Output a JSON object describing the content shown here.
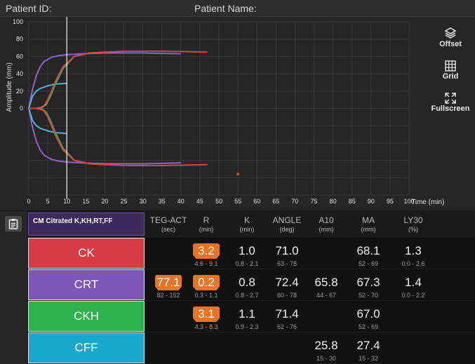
{
  "header": {
    "patient_id_label": "Patient ID:",
    "patient_name_label": "Patient Name:"
  },
  "side_buttons": {
    "offset": "Offset",
    "grid": "Grid",
    "fullscreen": "Fullscreen"
  },
  "chart_data": {
    "type": "line",
    "ylabel": "Amplitude (mm)",
    "xlabel": "Time (min)",
    "x_ticks": [
      "0",
      "5",
      "10",
      "15",
      "20",
      "25",
      "30",
      "35",
      "40",
      "45",
      "50",
      "55",
      "60",
      "65",
      "70",
      "75",
      "80",
      "85",
      "90",
      "95",
      "100"
    ],
    "y_ticks": [
      "100",
      "80",
      "60",
      "40",
      "20",
      "0"
    ],
    "xlim": [
      0,
      100
    ],
    "ylim": [
      -100,
      100
    ],
    "grid": true,
    "marker_x": 10,
    "series": [
      {
        "color": "#8e63c7",
        "x": [
          0,
          1,
          2,
          3,
          4,
          6,
          8,
          10,
          14,
          20,
          30,
          40
        ],
        "y": [
          0,
          22,
          38,
          48,
          54,
          59,
          61,
          62,
          63,
          64,
          64,
          63
        ]
      },
      {
        "color": "#4db3dc",
        "x": [
          0,
          1,
          2,
          3,
          5,
          7,
          10
        ],
        "y": [
          0,
          14,
          20,
          23,
          26,
          28,
          29
        ]
      },
      {
        "color": "#2fb25a",
        "x": [
          0,
          2,
          3.5,
          4.5,
          5.5,
          7,
          9,
          12,
          16,
          20
        ],
        "y": [
          0,
          0,
          1,
          4,
          12,
          28,
          46,
          60,
          64,
          65
        ]
      },
      {
        "color": "#e0404b",
        "x": [
          0,
          2,
          3,
          4,
          5,
          6,
          7,
          9,
          12,
          16,
          25,
          35,
          47
        ],
        "y": [
          0,
          0,
          1,
          3,
          10,
          20,
          31,
          48,
          60,
          64,
          66,
          66,
          65
        ]
      },
      {
        "color": "#8e63c7",
        "x": [
          0,
          1,
          2,
          3,
          4,
          6,
          8,
          10,
          14,
          20,
          30,
          40
        ],
        "y": [
          0,
          -22,
          -38,
          -48,
          -54,
          -59,
          -61,
          -62,
          -63,
          -64,
          -64,
          -63
        ]
      },
      {
        "color": "#4db3dc",
        "x": [
          0,
          1,
          2,
          3,
          5,
          7,
          10
        ],
        "y": [
          0,
          -14,
          -20,
          -23,
          -26,
          -28,
          -29
        ]
      },
      {
        "color": "#2fb25a",
        "x": [
          0,
          2,
          3.5,
          4.5,
          5.5,
          7,
          9,
          12,
          16,
          20
        ],
        "y": [
          0,
          0,
          -1,
          -4,
          -12,
          -28,
          -46,
          -60,
          -64,
          -65
        ]
      },
      {
        "color": "#e0404b",
        "x": [
          0,
          2,
          3,
          4,
          5,
          6,
          7,
          9,
          12,
          16,
          25,
          35,
          47
        ],
        "y": [
          0,
          0,
          -1,
          -3,
          -10,
          -20,
          -31,
          -48,
          -60,
          -64,
          -66,
          -66,
          -65
        ]
      }
    ],
    "point": {
      "x": 55,
      "y": -76,
      "color": "#e0404b"
    }
  },
  "table": {
    "sample_title": "CM Citrated K,KH,RT,FF",
    "headers": [
      {
        "name": "TEG-ACT",
        "unit": "(sec)"
      },
      {
        "name": "R",
        "unit": "(min)"
      },
      {
        "name": "K",
        "unit": "(min)"
      },
      {
        "name": "ANGLE",
        "unit": "(deg)"
      },
      {
        "name": "A10",
        "unit": "(mm)"
      },
      {
        "name": "MA",
        "unit": "(mm)"
      },
      {
        "name": "LY30",
        "unit": "(%)"
      }
    ],
    "rows": [
      {
        "label": "CK",
        "color": "#d63c46",
        "cells": [
          {
            "v": "",
            "r": ""
          },
          {
            "v": "3.2",
            "r": "4.6 - 9.1",
            "hi": true
          },
          {
            "v": "1.0",
            "r": "0.8 - 2.1"
          },
          {
            "v": "71.0",
            "r": "63 - 78"
          },
          {
            "v": "",
            "r": ""
          },
          {
            "v": "68.1",
            "r": "52 - 69"
          },
          {
            "v": "1.3",
            "r": "0.0 - 2.6"
          }
        ]
      },
      {
        "label": "CRT",
        "color": "#7d57b8",
        "cells": [
          {
            "v": "77.1",
            "r": "82 - 152",
            "hi": true
          },
          {
            "v": "0.2",
            "r": "0.3 - 1.1",
            "hi": true
          },
          {
            "v": "0.8",
            "r": "0.8 - 2.7"
          },
          {
            "v": "72.4",
            "r": "60 - 78"
          },
          {
            "v": "65.8",
            "r": "44 - 67"
          },
          {
            "v": "67.3",
            "r": "52 - 70"
          },
          {
            "v": "1.4",
            "r": "0.0 - 2.2"
          }
        ]
      },
      {
        "label": "CKH",
        "color": "#2db34e",
        "cells": [
          {
            "v": "",
            "r": ""
          },
          {
            "v": "3.1",
            "r": "4.3 - 8.3",
            "hi": true
          },
          {
            "v": "1.1",
            "r": "0.9 - 2.3"
          },
          {
            "v": "71.4",
            "r": "62 - 76"
          },
          {
            "v": "",
            "r": ""
          },
          {
            "v": "67.0",
            "r": "52 - 69"
          },
          {
            "v": "",
            "r": ""
          }
        ]
      },
      {
        "label": "CFF",
        "color": "#1ba8cf",
        "cells": [
          {
            "v": "",
            "r": ""
          },
          {
            "v": "",
            "r": ""
          },
          {
            "v": "",
            "r": ""
          },
          {
            "v": "",
            "r": ""
          },
          {
            "v": "25.8",
            "r": "15 - 30"
          },
          {
            "v": "27.4",
            "r": "15 - 32"
          },
          {
            "v": "",
            "r": ""
          }
        ]
      }
    ]
  }
}
